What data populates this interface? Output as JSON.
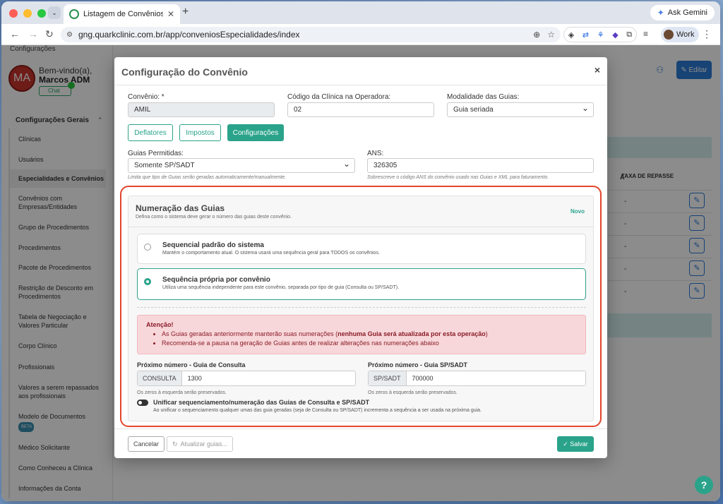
{
  "browser": {
    "tab_title": "Listagem de Convênios e Esp",
    "url": "gng.quarkclinic.com.br/app/conveniosEspecialidades/index",
    "gemini_label": "Ask Gemini",
    "profile_label": "Work"
  },
  "sidebar": {
    "header": "Configurações",
    "avatar_initials": "MA",
    "welcome": "Bem-vindo(a),",
    "user_name": "Marcos ADM",
    "chat_label": "Chat",
    "section_title": "Configurações Gerais",
    "items": [
      {
        "label": "Clínicas"
      },
      {
        "label": "Usuários"
      },
      {
        "label": "Especialidades e Convênios"
      },
      {
        "label": "Convênios com Empresas/Entidades"
      },
      {
        "label": "Grupo de Procedimentos"
      },
      {
        "label": "Procedimentos"
      },
      {
        "label": "Pacote de Procedimentos"
      },
      {
        "label": "Restrição de Desconto em Procedimentos"
      },
      {
        "label": "Tabela de Negociação e Valores Particular"
      },
      {
        "label": "Corpo Clínico"
      },
      {
        "label": "Profissionais"
      },
      {
        "label": "Valores a serem repassados aos profissionais"
      },
      {
        "label": "Modelo de Documentos",
        "badge": "BETA"
      },
      {
        "label": "Médico Solicitante"
      },
      {
        "label": "Como Conheceu a Clínica"
      },
      {
        "label": "Informações da Conta"
      }
    ]
  },
  "main": {
    "edit_label": "Editar",
    "col_a": "A",
    "col_taxa": "TAXA DE REPASSE",
    "row_dash": "-"
  },
  "modal": {
    "title": "Configuração do Convênio",
    "convenio_label": "Convênio: *",
    "convenio_value": "AMIL",
    "codigo_label": "Código da Clínica na Operadora:",
    "codigo_value": "02",
    "modalidade_label": "Modalidade das Guias:",
    "modalidade_value": "Guia seriada",
    "btn_deflatores": "Deflatores",
    "btn_impostos": "Impostos",
    "btn_configuracoes": "Configurações",
    "guias_label": "Guias Permitidas:",
    "guias_value": "Somente SP/SADT",
    "guias_hint": "Limita que tipo de Guias serão geradas automaticamente/manualmente.",
    "ans_label": "ANS:",
    "ans_value": "326305",
    "ans_hint": "Sobrescreve o código ANS do convênio usado nas Guias e XML para faturamento.",
    "numeracao": {
      "title": "Numeração das Guias",
      "subtitle": "Defina como o sistema deve gerar o número das guias deste convênio.",
      "badge": "Novo",
      "opt1_title": "Sequencial padrão do sistema",
      "opt1_desc": "Mantém o comportamento atual. O sistema usará uma sequência geral para TODOS os convênios.",
      "opt2_title": "Sequência própria por convênio",
      "opt2_desc": "Utiliza uma sequência independente para este convênio, separada por tipo de guia (Consulta ou SP/SADT).",
      "alert_title": "Atenção!",
      "alert_item1_a": "As Guias geradas anteriormente manterão suas numerações (",
      "alert_item1_b": "nenhuma Guia será atualizada por esta operação",
      "alert_item1_c": ")",
      "alert_item2": "Recomenda-se a pausa na geração de Guias antes de realizar alterações nas numerações abaixo",
      "consulta_label": "Próximo número - Guia de Consulta",
      "consulta_prefix": "CONSULTA",
      "consulta_value": "1300",
      "consulta_hint": "Os zeros à esquerda serão preservados.",
      "sadt_label": "Próximo número - Guia SP/SADT",
      "sadt_prefix": "SP/SADT",
      "sadt_value": "700000",
      "sadt_hint": "Os zeros à esquerda serão preservados.",
      "toggle_label": "Unificar sequenciamento/numeração das Guias de Consulta e SP/SADT",
      "toggle_desc": "Ao unificar o sequenciamento qualquer umas das guia geradas (seja de Consulta ou SP/SADT) incrementa a sequência a ser usada na próxima guia."
    },
    "btn_cancelar": "Cancelar",
    "btn_atualizar": "Atualizar guias...",
    "btn_salvar": "Salvar"
  },
  "colors": {
    "accent": "#2aa38a",
    "highlight_border": "#e2452b",
    "alert_bg": "#f8d7da",
    "edit_blue": "#2a7ad6"
  }
}
